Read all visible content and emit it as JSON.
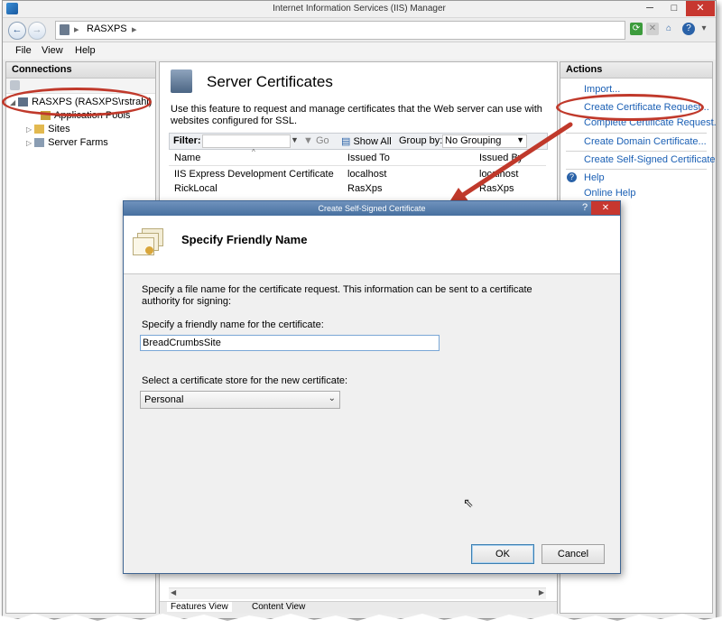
{
  "window": {
    "title": "Internet Information Services (IIS) Manager"
  },
  "address": {
    "crumb": "RASXPS",
    "crumb_arrow": "▸"
  },
  "menu": [
    "File",
    "View",
    "Help"
  ],
  "connections": {
    "header": "Connections",
    "root": "RASXPS (RASXPS\\rstrahl)",
    "children": [
      "Application Pools",
      "Sites",
      "Server Farms"
    ]
  },
  "main": {
    "title": "Server Certificates",
    "description": "Use this feature to request and manage certificates that the Web server can use with websites configured for SSL.",
    "filter_label": "Filter:",
    "go_label": "Go",
    "show_all_label": "Show All",
    "group_by_label": "Group by:",
    "group_by_value": "No Grouping",
    "columns": [
      "Name",
      "Issued To",
      "Issued By"
    ],
    "rows": [
      [
        "IIS Express Development Certificate",
        "localhost",
        "localhost"
      ],
      [
        "RickLocal",
        "RasXps",
        "RasXps"
      ]
    ]
  },
  "actions": {
    "header": "Actions",
    "items": [
      "Import...",
      "Create Certificate Request...",
      "Complete Certificate Request...",
      "Create Domain Certificate...",
      "Create Self-Signed Certificate...",
      "Help",
      "Online Help"
    ]
  },
  "dialog": {
    "title": "Create Self-Signed Certificate",
    "help_glyph": "?",
    "heading": "Specify Friendly Name",
    "description": "Specify a file name for the certificate request.  This information can be sent to a certificate authority for signing:",
    "friendly_label": "Specify a friendly name for the certificate:",
    "friendly_value": "BreadCrumbsSite",
    "store_label": "Select a certificate store for the new certificate:",
    "store_value": "Personal",
    "ok_label": "OK",
    "cancel_label": "Cancel"
  },
  "bottom_tabs": [
    "Features View",
    "Content View"
  ],
  "colors": {
    "accent": "#1a5fb4",
    "annotation": "#c0392b",
    "dialog_title": "#47709f",
    "close_red": "#c7372f"
  }
}
